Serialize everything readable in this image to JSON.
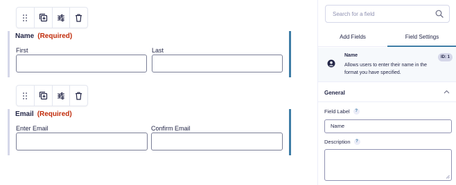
{
  "toolbar_icons": [
    "drag-handle-icon",
    "duplicate-icon",
    "settings-sliders-icon",
    "trash-icon"
  ],
  "fields": {
    "name": {
      "label": "Name",
      "required_text": "(Required)",
      "sub_first": "First",
      "sub_last": "Last"
    },
    "email": {
      "label": "Email",
      "required_text": "(Required)",
      "sub_enter": "Enter Email",
      "sub_confirm": "Confirm Email"
    }
  },
  "sidebar": {
    "search": {
      "placeholder": "Search for a field"
    },
    "tabs": {
      "add_fields": "Add Fields",
      "field_settings": "Field Settings",
      "active": "Field Settings"
    },
    "field_info": {
      "name": "Name",
      "description": "Allows users to enter their name in the format you have specified.",
      "id_badge": "ID: 1"
    },
    "general": {
      "title": "General",
      "field_label_title": "Field Label",
      "field_label_value": "Name",
      "description_title": "Description",
      "help_glyph": "?"
    }
  },
  "colors": {
    "accent": "#3e7da6",
    "required": "#c02b0a",
    "text": "#242748",
    "border": "#d5d7e9"
  }
}
